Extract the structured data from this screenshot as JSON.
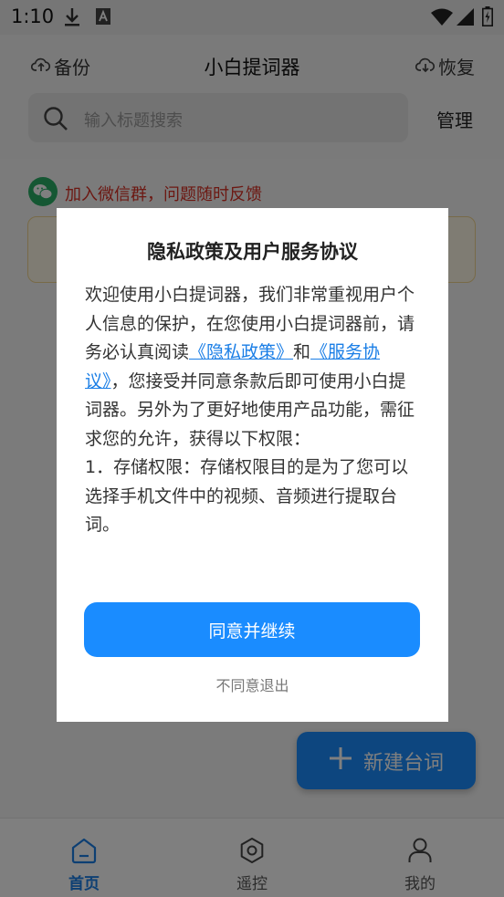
{
  "status_bar": {
    "time": "1:10"
  },
  "header": {
    "backup_label": "备份",
    "title": "小白提词器",
    "restore_label": "恢复",
    "search_placeholder": "输入标题搜索",
    "manage_label": "管理"
  },
  "content": {
    "wechat_notice": "加入微信群，问题随时反馈",
    "fab_label": "新建台词"
  },
  "tabs": [
    {
      "label": "首页",
      "active": true
    },
    {
      "label": "遥控",
      "active": false
    },
    {
      "label": "我的",
      "active": false
    }
  ],
  "dialog": {
    "title": "隐私政策及用户服务协议",
    "body_intro": "欢迎使用小白提词器，我们非常重视用户个人信息的保护，在您使用小白提词器前，请务必认真阅读",
    "privacy_link": "《隐私政策》",
    "and_text": "和",
    "service_link": "《服务协议》",
    "body_rest": "，您接受并同意条款后即可使用小白提词器。另外为了更好地使用产品功能，需征求您的允许，获得以下权限：",
    "permission_1": "1．存储权限：存储权限目的是为了您可以选择手机文件中的视频、音频进行提取台词。",
    "agree_label": "同意并继续",
    "disagree_label": "不同意退出"
  },
  "colors": {
    "accent": "#1a8cff",
    "link": "#1a7ee6",
    "warning_text": "#d93025",
    "wechat_green": "#2aae67"
  }
}
